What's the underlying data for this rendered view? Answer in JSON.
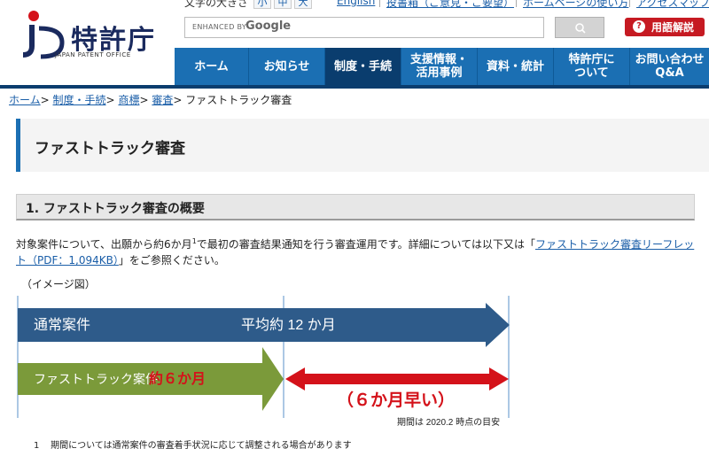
{
  "header": {
    "logo_title": "特許庁",
    "logo_subtitle": "JAPAN PATENT OFFICE",
    "font_size_label": "文字の大きさ",
    "font_sizes": [
      "小",
      "中",
      "大"
    ],
    "links": [
      "English",
      "投書箱（ご意見・ご要望）",
      "ホームページの使い方",
      "アクセスマップ"
    ],
    "search_brand_prefix": "ENHANCED BY",
    "search_brand": "Google",
    "glossary_label": "用語解説"
  },
  "nav": {
    "items": [
      {
        "label": "ホーム"
      },
      {
        "label": "お知らせ"
      },
      {
        "label": "制度・手続"
      },
      {
        "label": "支援情報・\n活用事例"
      },
      {
        "label": "資料・統計"
      },
      {
        "label": "特許庁に\nついて"
      },
      {
        "label": "お問い合わせ\nQ&A"
      }
    ]
  },
  "breadcrumb": {
    "items": [
      "ホーム",
      "制度・手続",
      "商標",
      "審査"
    ],
    "separator": ">",
    "current": "ファストトラック審査"
  },
  "page": {
    "title": "ファストトラック審査",
    "section_title": "1. ファストトラック審査の概要",
    "desc_part1": "対象案件について、出願から約6か月",
    "desc_sup": "1",
    "desc_part2": "で最初の審査結果通知を行う審査運用です。詳細については以下又は「",
    "desc_link": "ファストトラック審査リーフレット（PDF：1,094KB）",
    "desc_part3": "」をご参照ください。",
    "image_label": "（イメージ図）",
    "footnote_num": "1",
    "footnote_text": "期間については通常案件の審査着手状況に応じて調整される場合があります"
  },
  "diagram": {
    "normal_label": "通常案件",
    "normal_duration": "平均約 12 か月",
    "fast_label": "ファストトラック案件",
    "fast_duration": "約６か月",
    "faster_label": "（６か月早い）",
    "note": "期間は 2020.2 時点の目安",
    "colors": {
      "normal": "#2e5b8a",
      "fast": "#7b9a3a",
      "accent": "#d4121a"
    }
  }
}
